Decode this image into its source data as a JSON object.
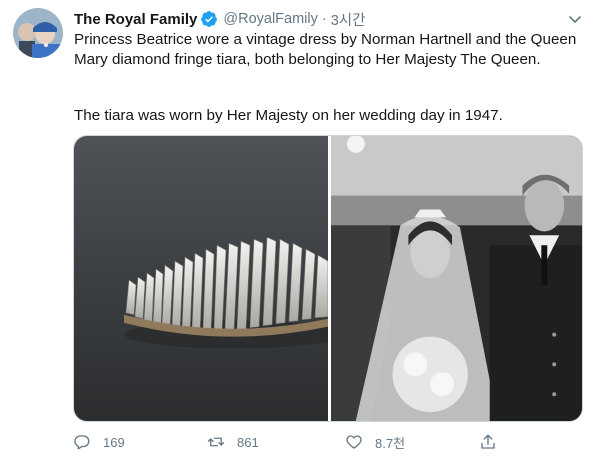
{
  "tweet": {
    "author_name": "The Royal Family",
    "handle": "@RoyalFamily",
    "separator": "·",
    "time": "3시간",
    "text_line1": "Princess Beatrice wore a vintage dress by Norman Hartnell and the Queen Mary diamond fringe tiara, both belonging to Her Majesty The Queen.",
    "text_line2": "The tiara was worn by Her Majesty on her wedding day in 1947."
  },
  "actions": {
    "reply_count": "169",
    "retweet_count": "861",
    "like_count": "8.7천"
  },
  "icons": {
    "verified": "verified-badge-icon",
    "caret": "chevron-down-icon",
    "reply": "reply-icon",
    "retweet": "retweet-icon",
    "like": "heart-icon",
    "share": "share-icon"
  },
  "colors": {
    "verified_blue": "#1da1f2",
    "muted_text": "#657786",
    "main_text": "#14171a"
  }
}
